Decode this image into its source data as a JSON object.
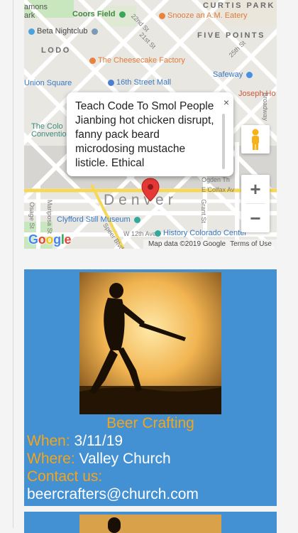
{
  "map": {
    "district_labels": [
      "CURTIS PARK",
      "FIVE POINTS",
      "LODO",
      "Denver"
    ],
    "poi_labels": [
      "Coors Field",
      "Snooze an A.M. Eatery",
      "Beta Nightclub",
      "The Cheesecake Factory",
      "16th Street Mall",
      "Safeway",
      "Joseph Ho",
      "Clyfford Still Museum",
      "History Colorado Center",
      "The Colo",
      "Convention Ce",
      "Union Square",
      "amons",
      "ark"
    ],
    "street_labels": [
      "22nd St",
      "21st St",
      "25th St",
      "Broadway",
      "Mariposa St",
      "Speer Blvd",
      "W 12th Ave",
      "Grant St",
      "E Colfax Av",
      "Ogden Th",
      "Osage St"
    ],
    "popup": {
      "title": "Teach Code To Smol People",
      "body": "Jianbing hot chicken disrupt, fanny pack beard microdosing mustache listicle. Ethical",
      "close_glyph": "×"
    },
    "zoom_in_glyph": "+",
    "zoom_out_glyph": "−",
    "logo": [
      "G",
      "o",
      "o",
      "g",
      "l",
      "e"
    ],
    "logo_colors": [
      "#4285f4",
      "#ea4335",
      "#fbbc05",
      "#4285f4",
      "#34a853",
      "#ea4335"
    ],
    "attribution": {
      "data": "Map data ©2019 Google",
      "terms": "Terms of Use"
    },
    "marker_color": "#e53935"
  },
  "event": {
    "title": "Beer Crafting",
    "when_label": "When:",
    "when_value": "3/11/19",
    "where_label": "Where:",
    "where_value": "Valley Church",
    "contact_label": "Contact us:",
    "contact_value": "beercrafters@church.com"
  },
  "colors": {
    "card_bg": "#4390d3",
    "label_accent": "#f3a51b",
    "value_text": "#ffffff"
  }
}
